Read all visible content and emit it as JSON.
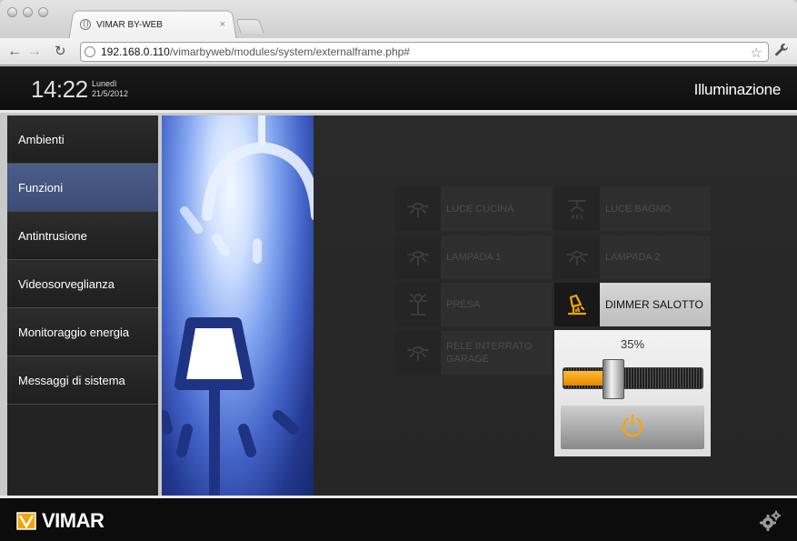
{
  "browser": {
    "tab_title": "VIMAR BY-WEB",
    "tab_close": "×",
    "url_domain": "192.168.0.110",
    "url_path": "/vimarbyweb/modules/system/externalframe.php#"
  },
  "header": {
    "time": "14:22",
    "weekday": "Lunedì",
    "date": "21/5/2012",
    "page_title": "Illuminazione"
  },
  "sidebar": {
    "items": [
      {
        "label": "Ambienti"
      },
      {
        "label": "Funzioni"
      },
      {
        "label": "Antintrusione"
      },
      {
        "label": "Videosorveglianza"
      },
      {
        "label": "Monitoraggio energia"
      },
      {
        "label": "Messaggi di sistema"
      }
    ],
    "active": "Funzioni"
  },
  "devices": [
    {
      "label": "LUCE CUCINA",
      "icon": "bulb-icon",
      "state": "off"
    },
    {
      "label": "LUCE BAGNO",
      "icon": "ceiling-light-icon",
      "state": "off"
    },
    {
      "label": "LAMPADA 1",
      "icon": "bulb-icon",
      "state": "off"
    },
    {
      "label": "LAMPADA 2",
      "icon": "bulb-icon",
      "state": "off"
    },
    {
      "label": "PRESA",
      "icon": "socket-lamp-icon",
      "state": "off"
    },
    {
      "label": "DIMMER SALOTTO",
      "icon": "dimmer-lamp-icon",
      "state": "on"
    },
    {
      "label": "RELE INTERRATO GARAGE",
      "icon": "bulb-icon",
      "state": "off"
    }
  ],
  "dimmer": {
    "value_label": "35%",
    "level": 0.35
  },
  "footer": {
    "brand": "VIMAR"
  },
  "colors": {
    "accent": "#f0a500",
    "active_nav": "#465784"
  }
}
